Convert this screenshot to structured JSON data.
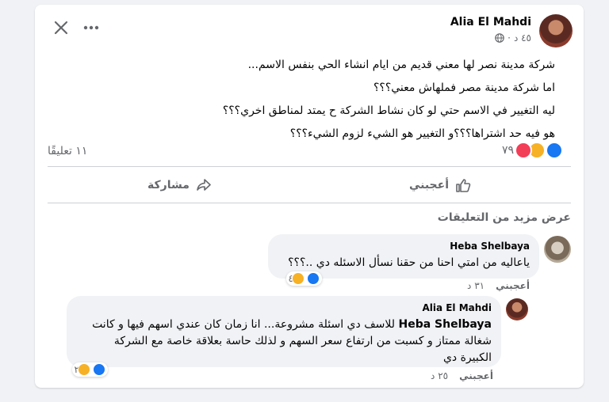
{
  "post": {
    "author": "Alia El Mahdi",
    "time": "٤٥ د",
    "lines": [
      "شركة مدينة نصر لها معني قديم من ايام انشاء الحي بنفس الاسم...",
      "اما شركة مدينة مصر فملهاش معني؟؟؟",
      "ليه التغيير في الاسم حتي لو كان نشاط الشركة ح يمتد لمناطق اخري؟؟؟",
      "هو فيه حد اشتراها؟؟؟و التغيير هو  الشيء لزوم الشيء؟؟؟"
    ],
    "reaction_count": "٧٩",
    "comments_count": "١١ تعليقًا",
    "like_label": "أعجبني",
    "share_label": "مشاركة"
  },
  "comments_section": {
    "more_comments": "عرض مزيد من التعليقات",
    "comments": [
      {
        "author": "Heba Shelbaya",
        "text": "ياعاليه من امتي احنا من حقنا نسأل الاسئله دي ..؟؟؟",
        "reaction_count": "٤",
        "like_label": "أعجبني",
        "time": "٣١ د"
      },
      {
        "author": "Alia El Mahdi",
        "mention": "Heba Shelbaya",
        "text_line1": " للاسف دي اسئلة مشروعة... انا زمان كان عندي اسهم فيها و كانت",
        "text_line2": "شغالة ممتاز و كسبت من ارتفاع سعر السهم و لذلك حاسة بعلاقة خاصة مع الشركة",
        "text_line3": "الكبيرة دي",
        "reaction_count": "٢",
        "like_label": "أعجبني",
        "time": "٢٥ د"
      }
    ]
  },
  "icons": {
    "close": "close-icon",
    "more": "more-icon",
    "globe": "globe-icon",
    "like": "thumbs-up-icon",
    "share": "share-icon"
  },
  "colors": {
    "like_blue": "#1877f2",
    "sad_yellow": "#f7b125",
    "love_red": "#f33e58",
    "muted_text": "#65676b"
  }
}
